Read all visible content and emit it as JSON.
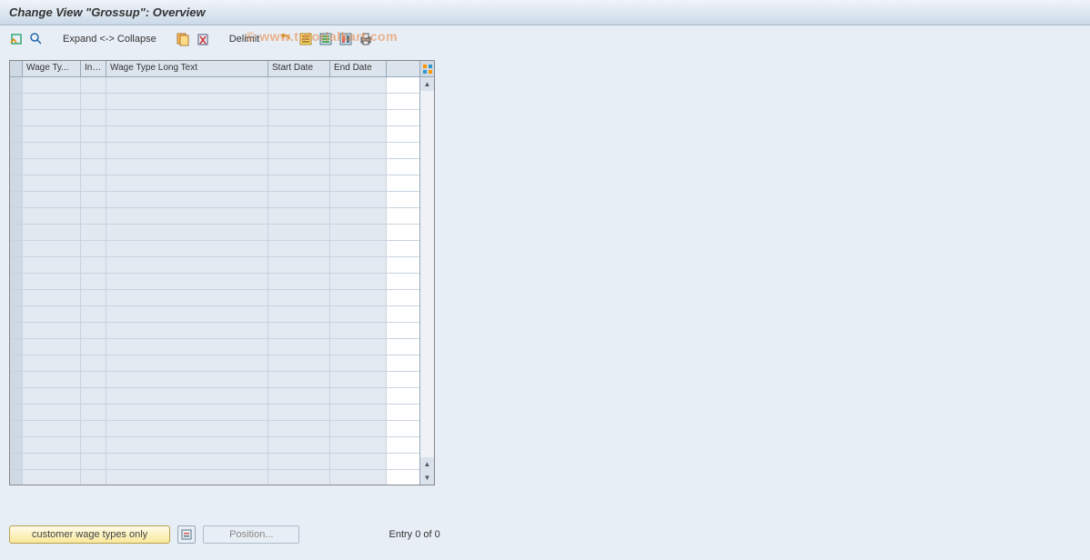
{
  "title": "Change View \"Grossup\": Overview",
  "toolbar": {
    "expand_collapse": "Expand <-> Collapse",
    "delimit": "Delimit"
  },
  "watermark": "© www.tutorialkart.com",
  "table": {
    "headers": {
      "col1": "Wage Ty...",
      "col2": "Inf...",
      "col3": "Wage Type Long Text",
      "col4": "Start Date",
      "col5": "End Date"
    },
    "row_count": 25
  },
  "footer": {
    "customer_btn": "customer wage types only",
    "position_btn": "Position...",
    "entry_text": "Entry 0 of 0"
  }
}
